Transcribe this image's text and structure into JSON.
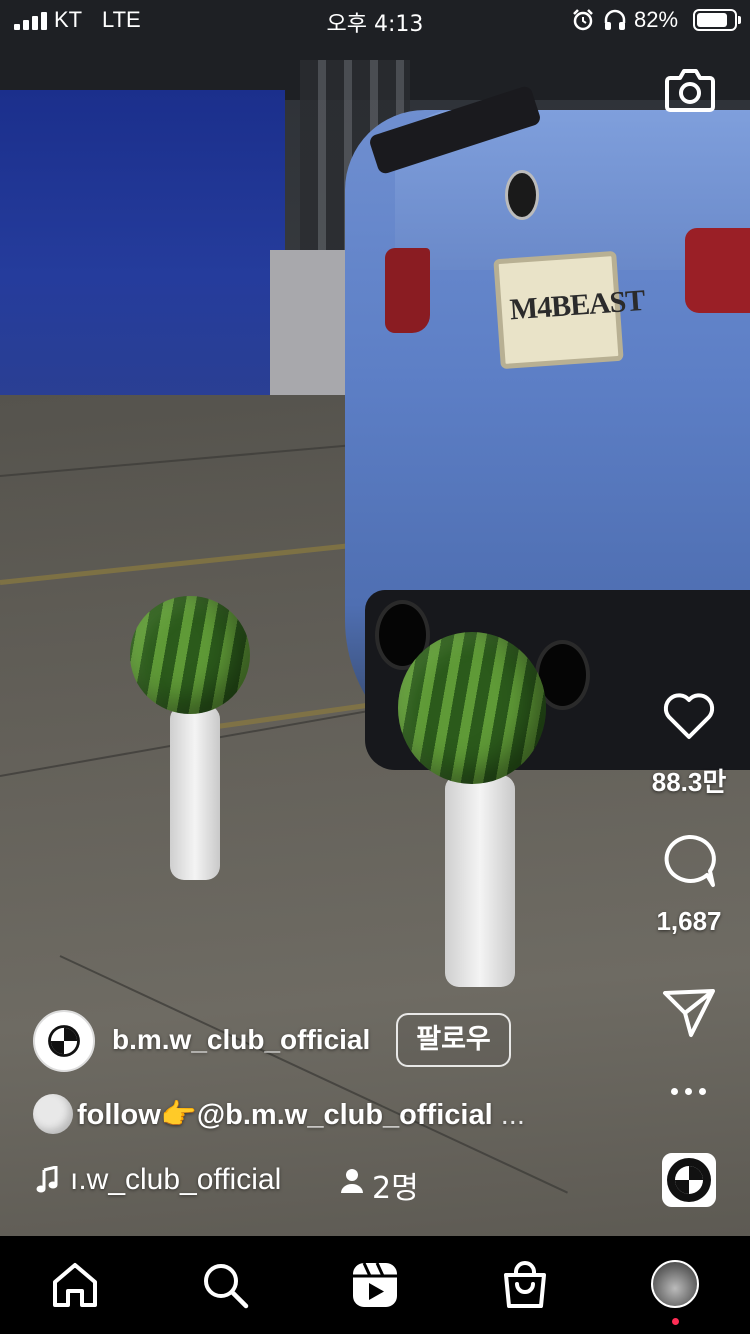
{
  "status_bar": {
    "carrier": "KT",
    "network": "LTE",
    "time": "오후 4:13",
    "battery_percent": "82%",
    "battery_level": 0.82,
    "icons": [
      "signal-icon",
      "alarm-icon",
      "headphones-icon",
      "battery-icon"
    ]
  },
  "video": {
    "plate_text": "M4BEAST"
  },
  "top": {
    "camera_icon": "camera-icon"
  },
  "actions": {
    "likes": "88.3만",
    "comments": "1,687",
    "icons": [
      "heart-icon",
      "comment-icon",
      "share-icon",
      "more-icon"
    ]
  },
  "post": {
    "username": "b.m.w_club_official",
    "follow_label": "팔로우",
    "caption_text": "follow👉@b.m.w_club_official",
    "caption_more": "...",
    "audio_text": "ı.w_club_official",
    "people_count": "2명"
  },
  "nav": {
    "items": [
      "home-icon",
      "search-icon",
      "reels-icon",
      "shop-icon",
      "profile-avatar"
    ],
    "accent_color": "#ff2d55"
  }
}
